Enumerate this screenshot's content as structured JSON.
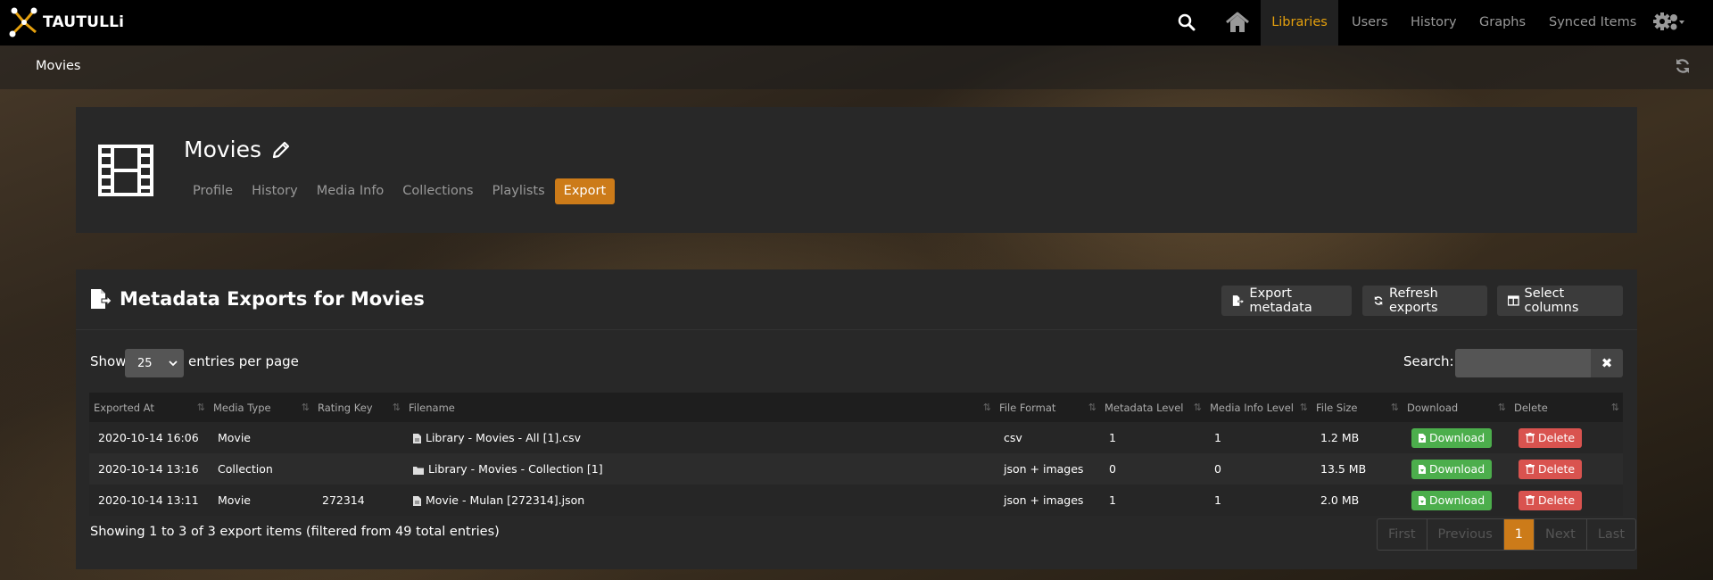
{
  "brand": {
    "name": "TAUTULLi"
  },
  "nav": {
    "items": [
      "Libraries",
      "Users",
      "History",
      "Graphs",
      "Synced Items"
    ],
    "active": "Libraries",
    "accent": "#e5a00d"
  },
  "breadcrumb": {
    "title": "Movies"
  },
  "library": {
    "title": "Movies",
    "tabs": [
      "Profile",
      "History",
      "Media Info",
      "Collections",
      "Playlists",
      "Export"
    ],
    "active_tab": "Export"
  },
  "exports_panel": {
    "heading": "Metadata Exports for Movies",
    "buttons": {
      "export": "Export metadata",
      "refresh": "Refresh exports",
      "columns": "Select columns"
    },
    "length": {
      "prefix": "Show",
      "value": "25",
      "suffix": "entries per page"
    },
    "search": {
      "label": "Search:",
      "value": ""
    },
    "columns": [
      "Exported At",
      "Media Type",
      "Rating Key",
      "Filename",
      "File Format",
      "Metadata Level",
      "Media Info Level",
      "File Size",
      "Download",
      "Delete"
    ],
    "rows": [
      {
        "exported_at": "2020-10-14 16:06",
        "media_type": "Movie",
        "rating_key": "",
        "file_icon": "file-icon",
        "filename": "Library - Movies - All [1].csv",
        "format": "csv",
        "metadata_level": "1",
        "media_info_level": "1",
        "file_size": "1.2 MB",
        "download": "Download",
        "delete": "Delete"
      },
      {
        "exported_at": "2020-10-14 13:16",
        "media_type": "Collection",
        "rating_key": "",
        "file_icon": "folder-icon",
        "filename": "Library - Movies - Collection [1]",
        "format": "json + images",
        "metadata_level": "0",
        "media_info_level": "0",
        "file_size": "13.5 MB",
        "download": "Download",
        "delete": "Delete"
      },
      {
        "exported_at": "2020-10-14 13:11",
        "media_type": "Movie",
        "rating_key": "272314",
        "file_icon": "file-icon",
        "filename": "Movie - Mulan [272314].json",
        "format": "json + images",
        "metadata_level": "1",
        "media_info_level": "1",
        "file_size": "2.0 MB",
        "download": "Download",
        "delete": "Delete"
      }
    ],
    "info": "Showing 1 to 3 of 3 export items (filtered from 49 total entries)",
    "pagination": [
      "First",
      "Previous",
      "1",
      "Next",
      "Last"
    ],
    "current_page": "1"
  }
}
